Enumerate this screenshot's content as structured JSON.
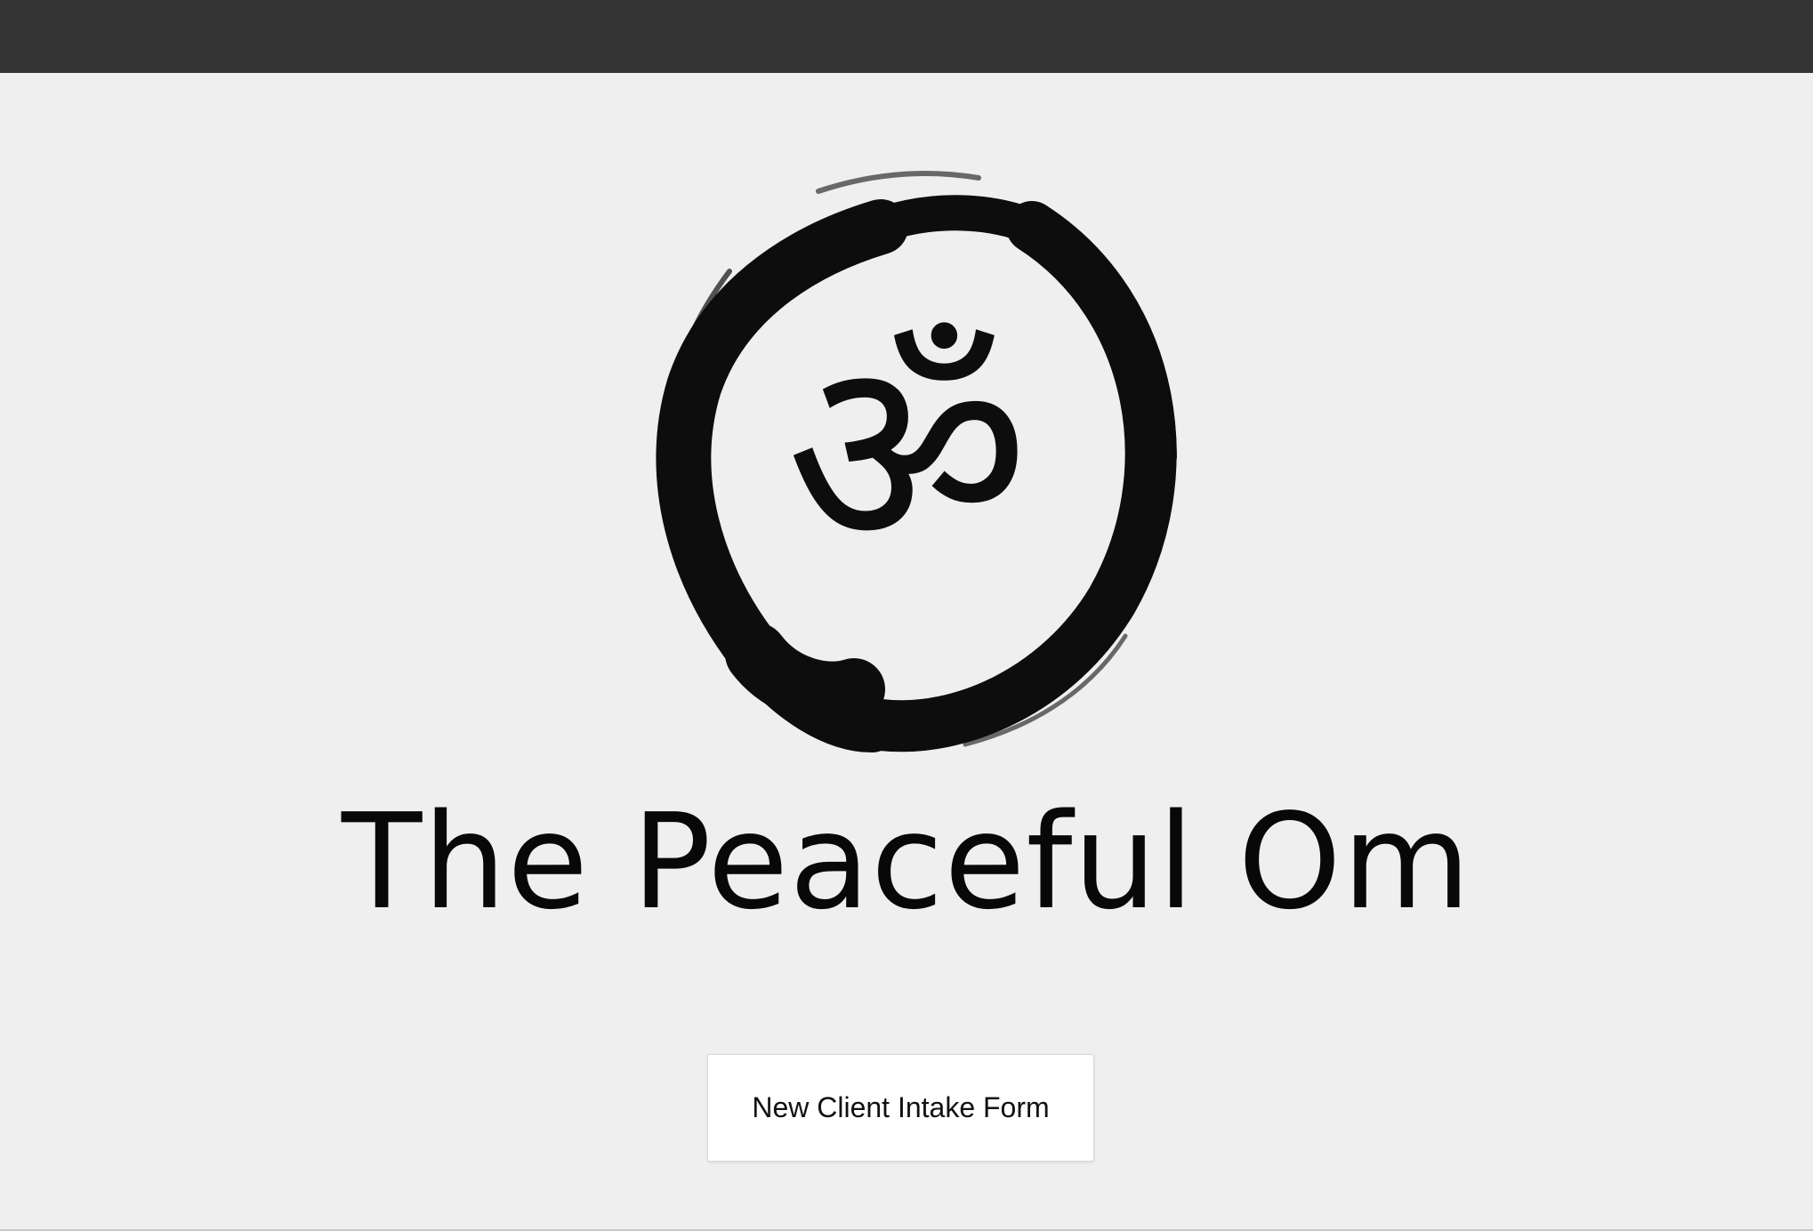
{
  "header": {
    "bar_color": "#333333"
  },
  "logo": {
    "icon": "om-enso-icon",
    "glyph": "ॐ",
    "ink_color": "#0d0d0d"
  },
  "main": {
    "title": "The Peaceful Om",
    "cta_label": "New Client Intake Form"
  },
  "colors": {
    "background": "#efefef",
    "text": "#080808"
  }
}
